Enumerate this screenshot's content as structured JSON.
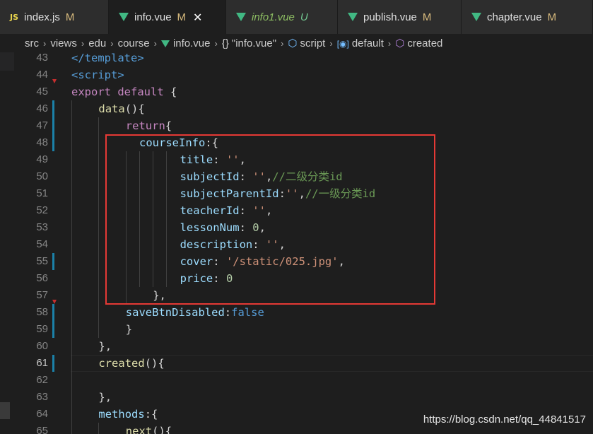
{
  "tabs": [
    {
      "icon": "js-icon",
      "icon_text": "JS",
      "label": "index.js",
      "status": "M",
      "status_kind": "m",
      "active": false,
      "italic": false,
      "width": 154
    },
    {
      "icon": "vue-icon",
      "label": "info.vue",
      "status": "M",
      "status_kind": "m",
      "active": true,
      "italic": false,
      "close": "✕",
      "width": 166
    },
    {
      "icon": "vue-icon",
      "label": "info1.vue",
      "status": "U",
      "status_kind": "u",
      "active": false,
      "italic": true,
      "width": 158
    },
    {
      "icon": "vue-icon",
      "label": "publish.vue",
      "status": "M",
      "status_kind": "m",
      "active": false,
      "italic": false,
      "width": 175
    },
    {
      "icon": "vue-icon",
      "label": "chapter.vue",
      "status": "M",
      "status_kind": "m",
      "active": false,
      "italic": false,
      "width": 186
    }
  ],
  "breadcrumb": {
    "folders": [
      "src",
      "views",
      "edu",
      "course"
    ],
    "file": "info.vue",
    "object": "\"info.vue\"",
    "object_icon": "{}",
    "script": "script",
    "default": "default",
    "method": "created",
    "separator": "›"
  },
  "lines": [
    {
      "n": "43",
      "indent": 2,
      "tokens": [
        [
          "tag",
          "</template>"
        ]
      ]
    },
    {
      "n": "44",
      "indent": 2,
      "tokens": [
        [
          "tag",
          "<script>"
        ]
      ]
    },
    {
      "n": "45",
      "indent": 2,
      "tokens": [
        [
          "kw2",
          "export"
        ],
        [
          "punc",
          " "
        ],
        [
          "kw2",
          "default"
        ],
        [
          "punc",
          " {"
        ]
      ]
    },
    {
      "n": "46",
      "indent": 6,
      "tokens": [
        [
          "fn",
          "data"
        ],
        [
          "punc",
          "(){"
        ]
      ]
    },
    {
      "n": "47",
      "indent": 10,
      "tokens": [
        [
          "kw2",
          "return"
        ],
        [
          "punc",
          "{"
        ]
      ]
    },
    {
      "n": "48",
      "indent": 12,
      "tokens": [
        [
          "prop",
          "courseInfo"
        ],
        [
          "punc",
          ":{"
        ]
      ]
    },
    {
      "n": "49",
      "indent": 18,
      "tokens": [
        [
          "prop",
          "title"
        ],
        [
          "punc",
          ": "
        ],
        [
          "str",
          "''"
        ],
        [
          "punc",
          ","
        ]
      ]
    },
    {
      "n": "50",
      "indent": 18,
      "tokens": [
        [
          "prop",
          "subjectId"
        ],
        [
          "punc",
          ": "
        ],
        [
          "str",
          "''"
        ],
        [
          "punc",
          ","
        ],
        [
          "cmt",
          "//二级分类id"
        ]
      ]
    },
    {
      "n": "51",
      "indent": 18,
      "tokens": [
        [
          "prop",
          "subjectParentId"
        ],
        [
          "punc",
          ":"
        ],
        [
          "str",
          "''"
        ],
        [
          "punc",
          ","
        ],
        [
          "cmt",
          "//一级分类id"
        ]
      ]
    },
    {
      "n": "52",
      "indent": 18,
      "tokens": [
        [
          "prop",
          "teacherId"
        ],
        [
          "punc",
          ": "
        ],
        [
          "str",
          "''"
        ],
        [
          "punc",
          ","
        ]
      ]
    },
    {
      "n": "53",
      "indent": 18,
      "tokens": [
        [
          "prop",
          "lessonNum"
        ],
        [
          "punc",
          ": "
        ],
        [
          "num",
          "0"
        ],
        [
          "punc",
          ","
        ]
      ]
    },
    {
      "n": "54",
      "indent": 18,
      "tokens": [
        [
          "prop",
          "description"
        ],
        [
          "punc",
          ": "
        ],
        [
          "str",
          "''"
        ],
        [
          "punc",
          ","
        ]
      ]
    },
    {
      "n": "55",
      "indent": 18,
      "tokens": [
        [
          "prop",
          "cover"
        ],
        [
          "punc",
          ": "
        ],
        [
          "str",
          "'/static/025.jpg'"
        ],
        [
          "punc",
          ","
        ]
      ]
    },
    {
      "n": "56",
      "indent": 18,
      "tokens": [
        [
          "prop",
          "price"
        ],
        [
          "punc",
          ": "
        ],
        [
          "num",
          "0"
        ]
      ]
    },
    {
      "n": "57",
      "indent": 14,
      "tokens": [
        [
          "punc",
          "},"
        ]
      ]
    },
    {
      "n": "58",
      "indent": 10,
      "tokens": [
        [
          "prop",
          "saveBtnDisabled"
        ],
        [
          "punc",
          ":"
        ],
        [
          "bool",
          "false"
        ]
      ]
    },
    {
      "n": "59",
      "indent": 10,
      "tokens": [
        [
          "punc",
          "}"
        ]
      ]
    },
    {
      "n": "60",
      "indent": 6,
      "tokens": [
        [
          "punc",
          "},"
        ]
      ]
    },
    {
      "n": "61",
      "indent": 6,
      "tokens": [
        [
          "fn",
          "created"
        ],
        [
          "punc",
          "(){"
        ]
      ],
      "current": true
    },
    {
      "n": "62",
      "indent": 6,
      "tokens": []
    },
    {
      "n": "63",
      "indent": 6,
      "tokens": [
        [
          "punc",
          "},"
        ]
      ]
    },
    {
      "n": "64",
      "indent": 6,
      "tokens": [
        [
          "prop",
          "methods"
        ],
        [
          "punc",
          ":{"
        ]
      ]
    },
    {
      "n": "65",
      "indent": 10,
      "tokens": [
        [
          "fn",
          "next"
        ],
        [
          "punc",
          "(){"
        ]
      ]
    }
  ],
  "modified_lines": [
    "46",
    "47",
    "48",
    "55",
    "58",
    "59",
    "61"
  ],
  "fold_lines": [
    "45",
    "58"
  ],
  "watermark": "https://blog.csdn.net/qq_44841517",
  "colors": {
    "background": "#1e1e1e",
    "tabbar": "#252526",
    "highlight_box": "#e53935",
    "keyword": "#569cd6",
    "control": "#c586c0",
    "function": "#dcdcaa",
    "property": "#9cdcfe",
    "string": "#ce9178",
    "number": "#b5cea8",
    "comment": "#6a9955"
  }
}
